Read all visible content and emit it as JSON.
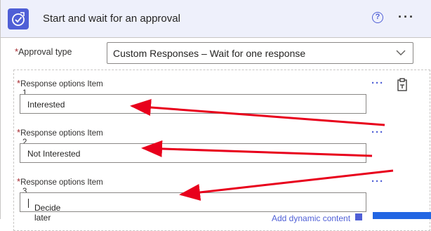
{
  "header": {
    "title": "Start and wait for an approval",
    "help_icon": "help-icon",
    "more_icon": "more-icon",
    "help_glyph": "?",
    "more_glyph": "···"
  },
  "approval_type": {
    "label": "Approval type",
    "required_mark": "*",
    "value": "Custom Responses – Wait for one response"
  },
  "response_options": [
    {
      "label": "Response options Item",
      "index": "1",
      "value": "Interested"
    },
    {
      "label": "Response options Item",
      "index": "2",
      "value": "Not Interested"
    },
    {
      "label": "Response options Item",
      "index": "3",
      "value": "Decide later"
    }
  ],
  "item_more_glyph": "···",
  "add_dynamic": "Add dynamic content",
  "colors": {
    "accent": "#4f5fd6",
    "arrow": "#e8001c",
    "header_bg": "#eef0fb",
    "required": "#a4262c"
  }
}
